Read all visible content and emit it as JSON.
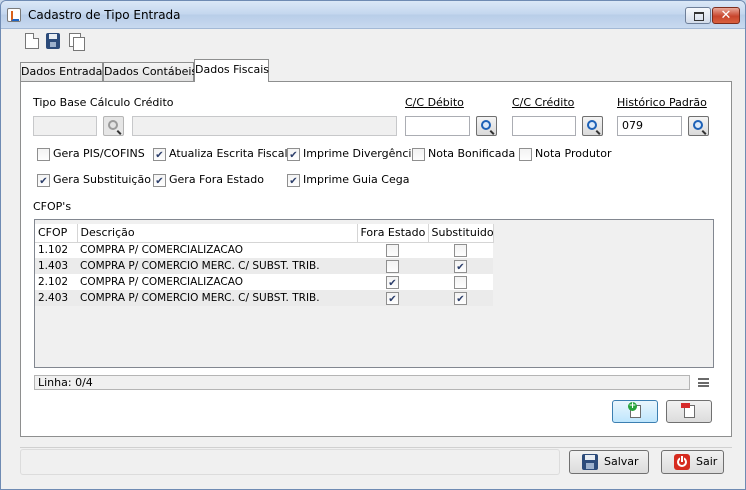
{
  "window": {
    "title": "Cadastro de Tipo Entrada"
  },
  "toolbar": {
    "icons": [
      "new-document-icon",
      "save-icon",
      "copy-icon"
    ]
  },
  "tabs": [
    {
      "label": "Dados Entrada",
      "active": false
    },
    {
      "label": "Dados Contábeis",
      "active": false
    },
    {
      "label": "Dados Fiscais",
      "active": true
    }
  ],
  "fiscal": {
    "tipo_base_label": "Tipo Base Cálculo Crédito",
    "cc_debito_label": "C/C Débito",
    "cc_credito_label": "C/C Crédito",
    "historico_label": "Histórico Padrão",
    "historico_value": "079",
    "checkboxes": [
      {
        "label": "Gera PIS/COFINS",
        "checked": false
      },
      {
        "label": "Atualiza Escrita Fiscal",
        "checked": true
      },
      {
        "label": "Imprime Divergência",
        "checked": true
      },
      {
        "label": "Nota Bonificada",
        "checked": false
      },
      {
        "label": "Nota Produtor",
        "checked": false
      },
      {
        "label": "Gera Substituição",
        "checked": true
      },
      {
        "label": "Gera Fora Estado",
        "checked": true
      },
      {
        "label": "Imprime Guia Cega",
        "checked": true
      }
    ]
  },
  "cfops": {
    "label": "CFOP's",
    "columns": [
      "CFOP",
      "Descrição",
      "Fora Estado",
      "Substituido"
    ],
    "rows": [
      {
        "cfop": "1.102",
        "descricao": "COMPRA P/ COMERCIALIZACAO",
        "fora_estado": false,
        "substituido": false
      },
      {
        "cfop": "1.403",
        "descricao": "COMPRA P/ COMERCIO MERC. C/ SUBST. TRIB.",
        "fora_estado": false,
        "substituido": true
      },
      {
        "cfop": "2.102",
        "descricao": "COMPRA P/ COMERCIALIZACAO",
        "fora_estado": true,
        "substituido": false
      },
      {
        "cfop": "2.403",
        "descricao": "COMPRA P/ COMERCIO MERC. C/ SUBST. TRIB.",
        "fora_estado": true,
        "substituido": true
      }
    ],
    "status": "Linha: 0/4"
  },
  "footer": {
    "save_label": "Salvar",
    "exit_label": "Sair"
  }
}
